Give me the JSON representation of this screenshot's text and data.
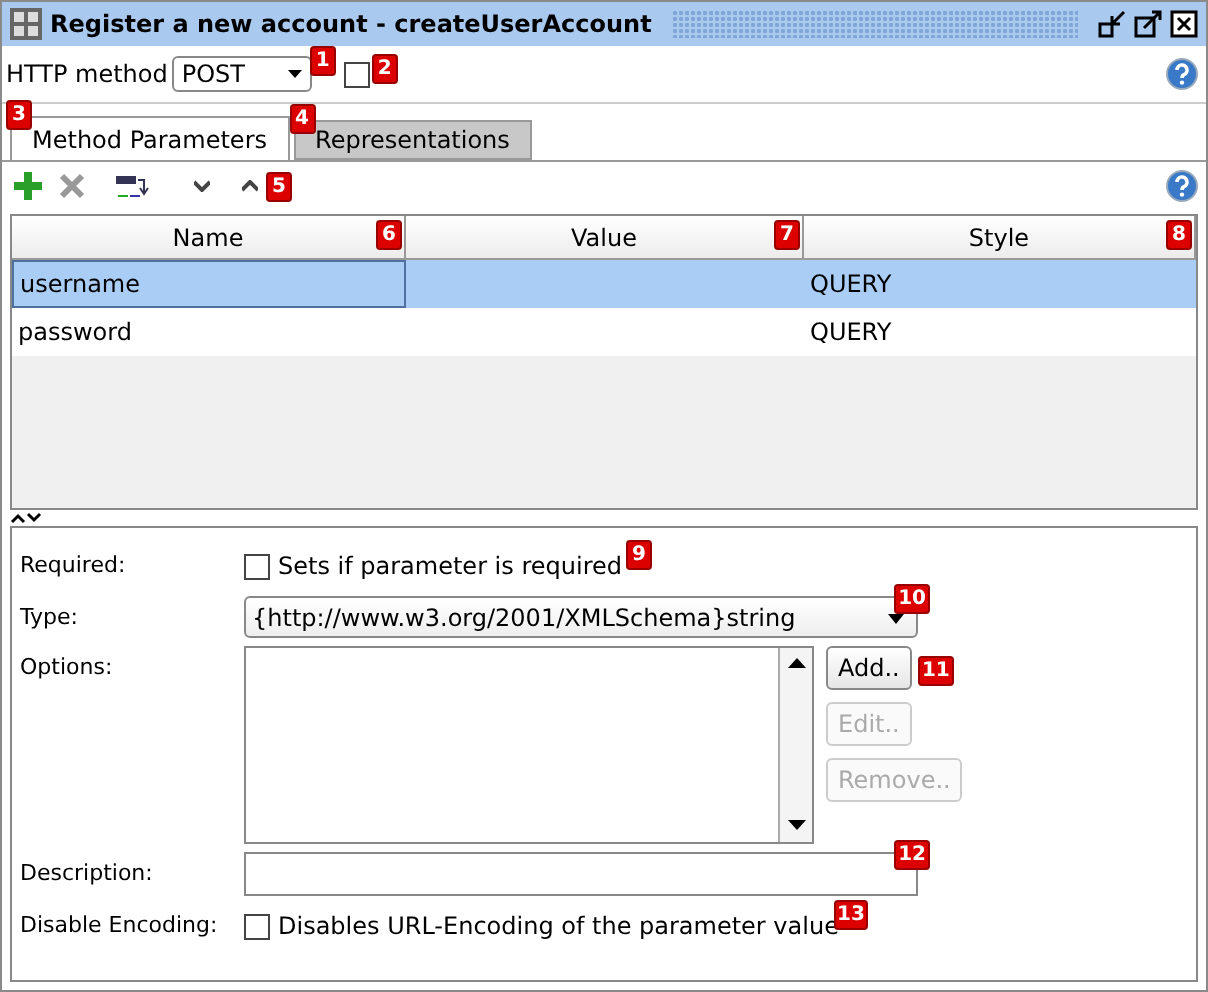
{
  "window": {
    "title": "Register a new account - createUserAccount"
  },
  "http_method": {
    "label": "HTTP method",
    "value": "POST",
    "badge": "1",
    "checkbox": {
      "checked": false,
      "badge": "2"
    }
  },
  "tabs": [
    {
      "label": "Method Parameters",
      "selected": true,
      "badge": "3"
    },
    {
      "label": "Representations",
      "selected": false,
      "badge": "4"
    }
  ],
  "toolbar": {
    "badge": "5"
  },
  "table": {
    "columns": [
      {
        "label": "Name",
        "badge": "6"
      },
      {
        "label": "Value",
        "badge": "7"
      },
      {
        "label": "Style",
        "badge": "8"
      }
    ],
    "rows": [
      {
        "cells": [
          "username",
          "",
          "QUERY"
        ],
        "selected": true
      },
      {
        "cells": [
          "password",
          "",
          "QUERY"
        ],
        "selected": false
      }
    ]
  },
  "details": {
    "required": {
      "label": "Required:",
      "text": "Sets if parameter is required",
      "checked": false,
      "badge": "9"
    },
    "type": {
      "label": "Type:",
      "value": "{http://www.w3.org/2001/XMLSchema}string",
      "badge": "10"
    },
    "options": {
      "label": "Options:",
      "buttons": [
        {
          "label": "Add..",
          "disabled": false,
          "badge": "11"
        },
        {
          "label": "Edit..",
          "disabled": true
        },
        {
          "label": "Remove..",
          "disabled": true
        }
      ]
    },
    "description": {
      "label": "Description:",
      "badge": "12"
    },
    "disable_encoding": {
      "label": "Disable Encoding:",
      "text": "Disables URL-Encoding of the parameter value",
      "checked": false,
      "badge": "13"
    }
  }
}
